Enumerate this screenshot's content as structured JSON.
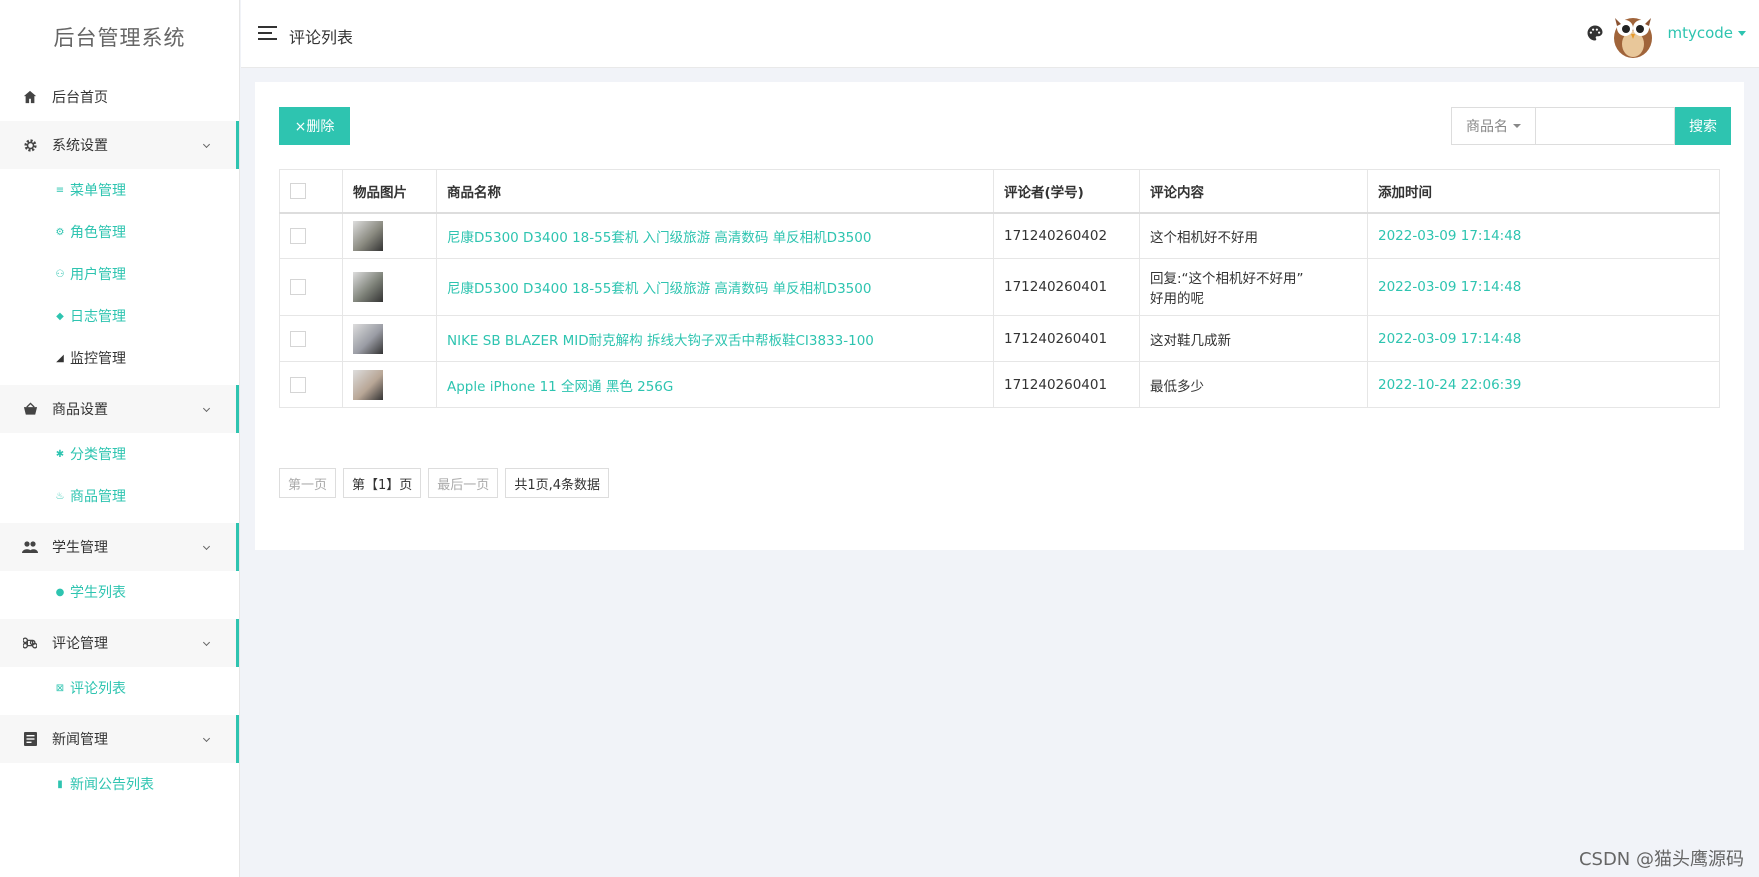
{
  "app": {
    "brand": "后台管理系统"
  },
  "sidebar": {
    "items": [
      {
        "type": "item",
        "label": "后台首页",
        "icon": "home-icon"
      },
      {
        "type": "group",
        "label": "系统设置",
        "icon": "gear-icon"
      },
      {
        "type": "sub",
        "label": "菜单管理",
        "icon": "list-icon"
      },
      {
        "type": "sub",
        "label": "角色管理",
        "icon": "user-gear-icon"
      },
      {
        "type": "sub",
        "label": "用户管理",
        "icon": "users-icon"
      },
      {
        "type": "sub",
        "label": "日志管理",
        "icon": "tag-icon"
      },
      {
        "type": "sub",
        "label": "监控管理",
        "icon": "monitor-icon"
      },
      {
        "type": "group",
        "label": "商品设置",
        "icon": "basket-icon"
      },
      {
        "type": "sub",
        "label": "分类管理",
        "icon": "asterisk-icon"
      },
      {
        "type": "sub",
        "label": "商品管理",
        "icon": "goods-icon"
      },
      {
        "type": "group",
        "label": "学生管理",
        "icon": "students-icon"
      },
      {
        "type": "sub",
        "label": "学生列表",
        "icon": "student-icon"
      },
      {
        "type": "group",
        "label": "评论管理",
        "icon": "command-icon"
      },
      {
        "type": "sub",
        "label": "评论列表",
        "icon": "comment-list-icon"
      },
      {
        "type": "group",
        "label": "新闻管理",
        "icon": "news-icon"
      },
      {
        "type": "sub",
        "label": "新闻公告列表",
        "icon": "book-icon"
      }
    ]
  },
  "header": {
    "title": "评论列表",
    "username": "mtycode"
  },
  "toolbar": {
    "delete_label": "×删除",
    "search_field": "商品名",
    "search_placeholder": "",
    "search_label": "搜索"
  },
  "table": {
    "headers": [
      "物品图片",
      "商品名称",
      "评论者(学号)",
      "评论内容",
      "添加时间"
    ],
    "rows": [
      {
        "name": "尼康D5300 D3400 18-55套机 入门级旅游 高清数码 单反相机D3500",
        "commenter": "171240260402",
        "content": "这个相机好不好用",
        "content2": "",
        "time": "2022-03-09 17:14:48",
        "thumb": "#8a8a80"
      },
      {
        "name": "尼康D5300 D3400 18-55套机 入门级旅游 高清数码 单反相机D3500",
        "commenter": "171240260401",
        "content": "回复:“这个相机好不好用”",
        "content2": "好用的呢",
        "time": "2022-03-09 17:14:48",
        "thumb": "#7e8279"
      },
      {
        "name": "NIKE SB BLAZER MID耐克解构 拆线大钩子双舌中帮板鞋CI3833-100",
        "commenter": "171240260401",
        "content": "这对鞋几成新",
        "content2": "",
        "time": "2022-03-09 17:14:48",
        "thumb": "#9a9ca4"
      },
      {
        "name": "Apple iPhone 11 全网通 黑色 256G",
        "commenter": "171240260401",
        "content": "最低多少",
        "content2": "",
        "time": "2022-10-24 22:06:39",
        "thumb": "#b8a696"
      }
    ]
  },
  "pager": {
    "first": "第一页",
    "current": "第【1】页",
    "last": "最后一页",
    "summary": "共1页,4条数据"
  },
  "watermark": "CSDN @猫头鹰源码",
  "colors": {
    "accent": "#2ec4b0"
  }
}
